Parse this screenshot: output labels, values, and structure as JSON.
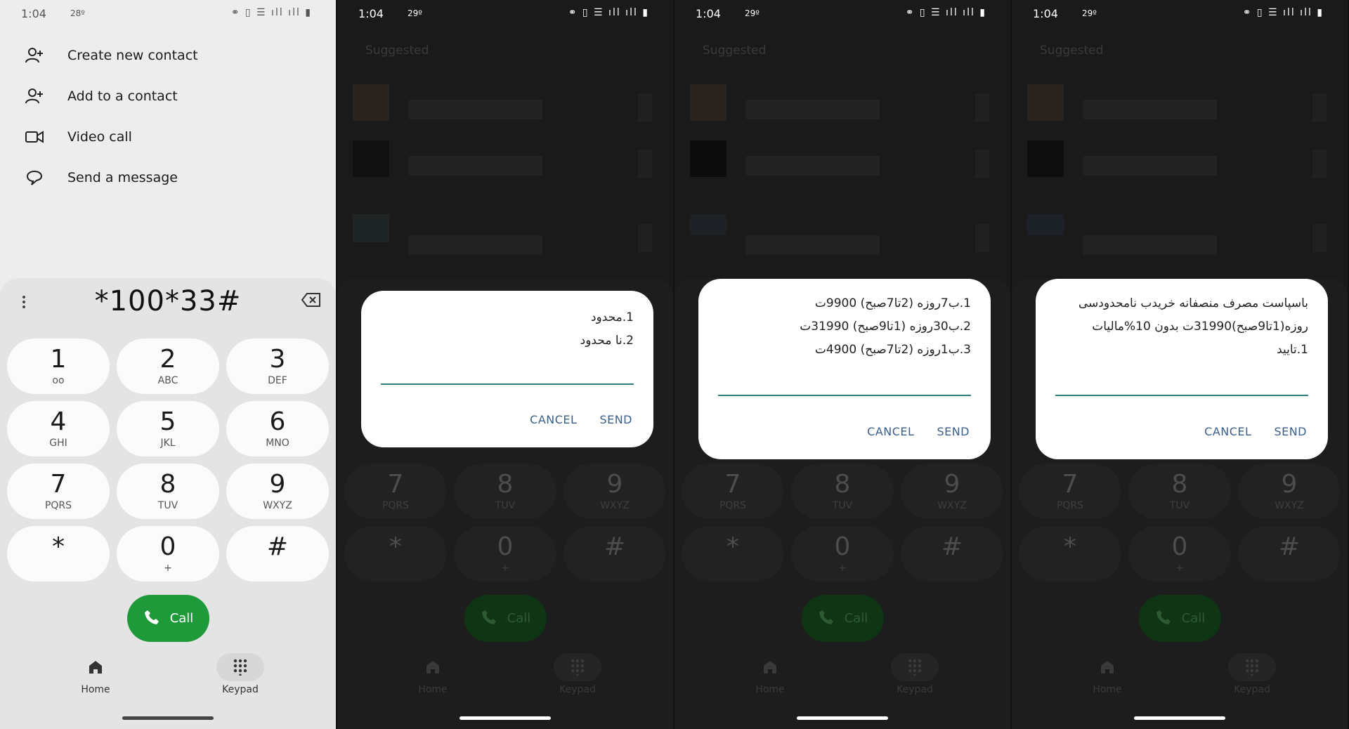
{
  "status": {
    "time": "1:04",
    "temp_light": "28º",
    "temp_dark": "29º",
    "icons": "⚭ ▯ ☰ ıll ıll ▮"
  },
  "menu": [
    {
      "label": "Create new contact",
      "icon": "add-person-icon"
    },
    {
      "label": "Add to a contact",
      "icon": "add-person-icon"
    },
    {
      "label": "Video call",
      "icon": "video-icon"
    },
    {
      "label": "Send a message",
      "icon": "message-icon"
    }
  ],
  "dialer": {
    "number": "*100*33#"
  },
  "keys": [
    {
      "digit": "1",
      "letters": "ᴏᴏ"
    },
    {
      "digit": "2",
      "letters": "ABC"
    },
    {
      "digit": "3",
      "letters": "DEF"
    },
    {
      "digit": "4",
      "letters": "GHI"
    },
    {
      "digit": "5",
      "letters": "JKL"
    },
    {
      "digit": "6",
      "letters": "MNO"
    },
    {
      "digit": "7",
      "letters": "PQRS"
    },
    {
      "digit": "8",
      "letters": "TUV"
    },
    {
      "digit": "9",
      "letters": "WXYZ"
    },
    {
      "digit": "*",
      "letters": ""
    },
    {
      "digit": "0",
      "letters": "+"
    },
    {
      "digit": "#",
      "letters": ""
    }
  ],
  "call": {
    "label": "Call"
  },
  "nav": {
    "home": "Home",
    "keypad": "Keypad"
  },
  "suggested": "Suggested",
  "dialogs": [
    {
      "lines": [
        "1.محدود",
        "2.نا محدود"
      ],
      "cancel": "CANCEL",
      "send": "SEND"
    },
    {
      "lines": [
        "1.ب7روزه (2تا7صبح) 9900ت",
        "2.ب30روزه (1تا9صبح) 31990ت",
        "3.ب1روزه (2تا7صبح) 4900ت"
      ],
      "cancel": "CANCEL",
      "send": "SEND"
    },
    {
      "lines": [
        "باسپاست مصرف منصفانه خریدب نامحدودسی",
        "روزه(1تا9صبح)31990ت بدون 10%مالیات",
        "1.تایید"
      ],
      "cancel": "CANCEL",
      "send": "SEND"
    }
  ]
}
